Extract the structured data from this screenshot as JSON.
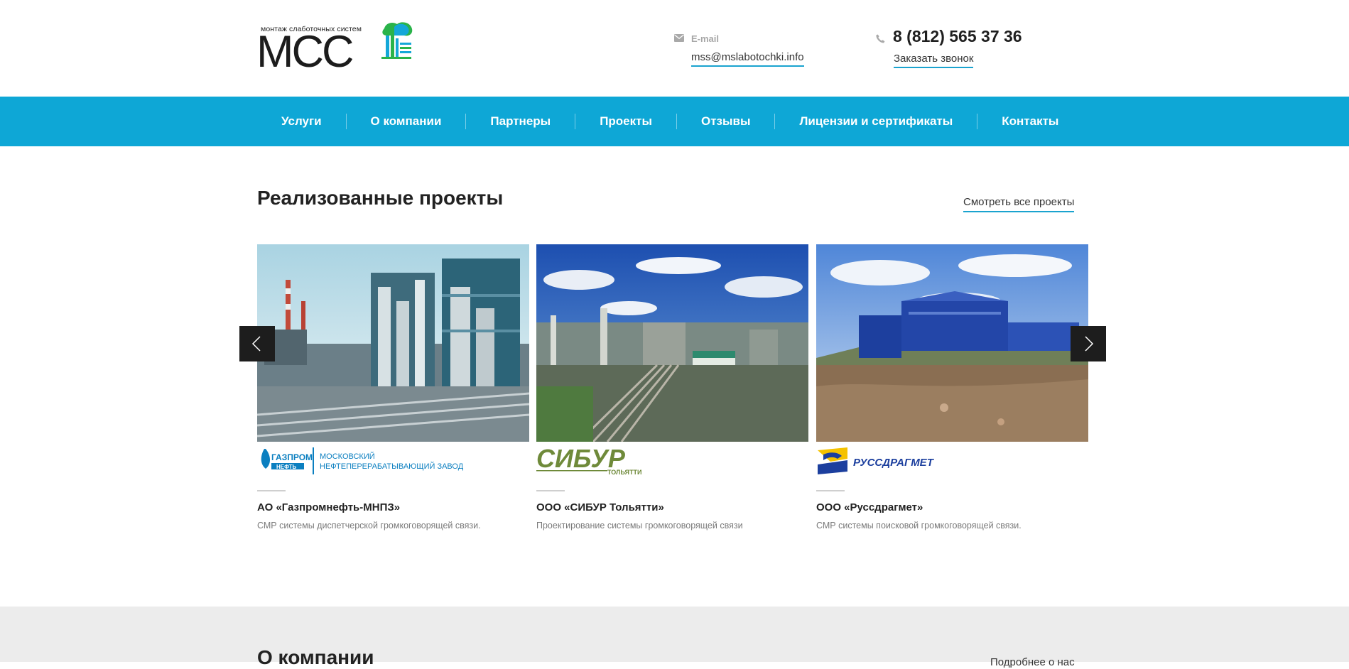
{
  "header": {
    "logo_sub": "монтаж слаботочных систем",
    "logo_main": "МСС",
    "email_label": "E-mail",
    "email": "mss@mslabotochki.info",
    "phone": "8 (812) 565 37 36",
    "callback": "Заказать звонок"
  },
  "nav": {
    "items": [
      {
        "label": "Услуги"
      },
      {
        "label": "О компании"
      },
      {
        "label": "Партнеры"
      },
      {
        "label": "Проекты"
      },
      {
        "label": "Отзывы"
      },
      {
        "label": "Лицензии и сертификаты"
      },
      {
        "label": "Контакты"
      }
    ]
  },
  "projects": {
    "title": "Реализованные проекты",
    "view_all": "Смотреть все проекты",
    "cards": [
      {
        "brand_logo": [
          "ГАЗПРОМ",
          "НЕФТЬ",
          "МОСКОВСКИЙ",
          "НЕФТЕПЕРЕРАБАТЫВАЮЩИЙ ЗАВОД"
        ],
        "name": "АО «Газпромнефть-МНПЗ»",
        "desc": "СМР системы диспетчерской громкоговорящей связи."
      },
      {
        "brand_logo": [
          "СИБУР",
          "ТОЛЬЯТТИ"
        ],
        "name": "ООО «СИБУР Тольятти»",
        "desc": "Проектирование системы громкоговорящей связи"
      },
      {
        "brand_logo": [
          "РУССДРАГМЕТ"
        ],
        "name": "ООО «Руссдрагмет»",
        "desc": "СМР системы поисковой громкоговорящей связи."
      }
    ]
  },
  "about": {
    "title": "О компании",
    "more": "Подробнее о нас"
  },
  "colors": {
    "accent": "#0ea7d6",
    "underline": "#1aa3cf",
    "arrow_bg": "#1d1d1d",
    "about_bg": "#ececec"
  },
  "icons": [
    "envelope-icon",
    "phone-icon",
    "arrow-left-icon",
    "arrow-right-icon"
  ]
}
